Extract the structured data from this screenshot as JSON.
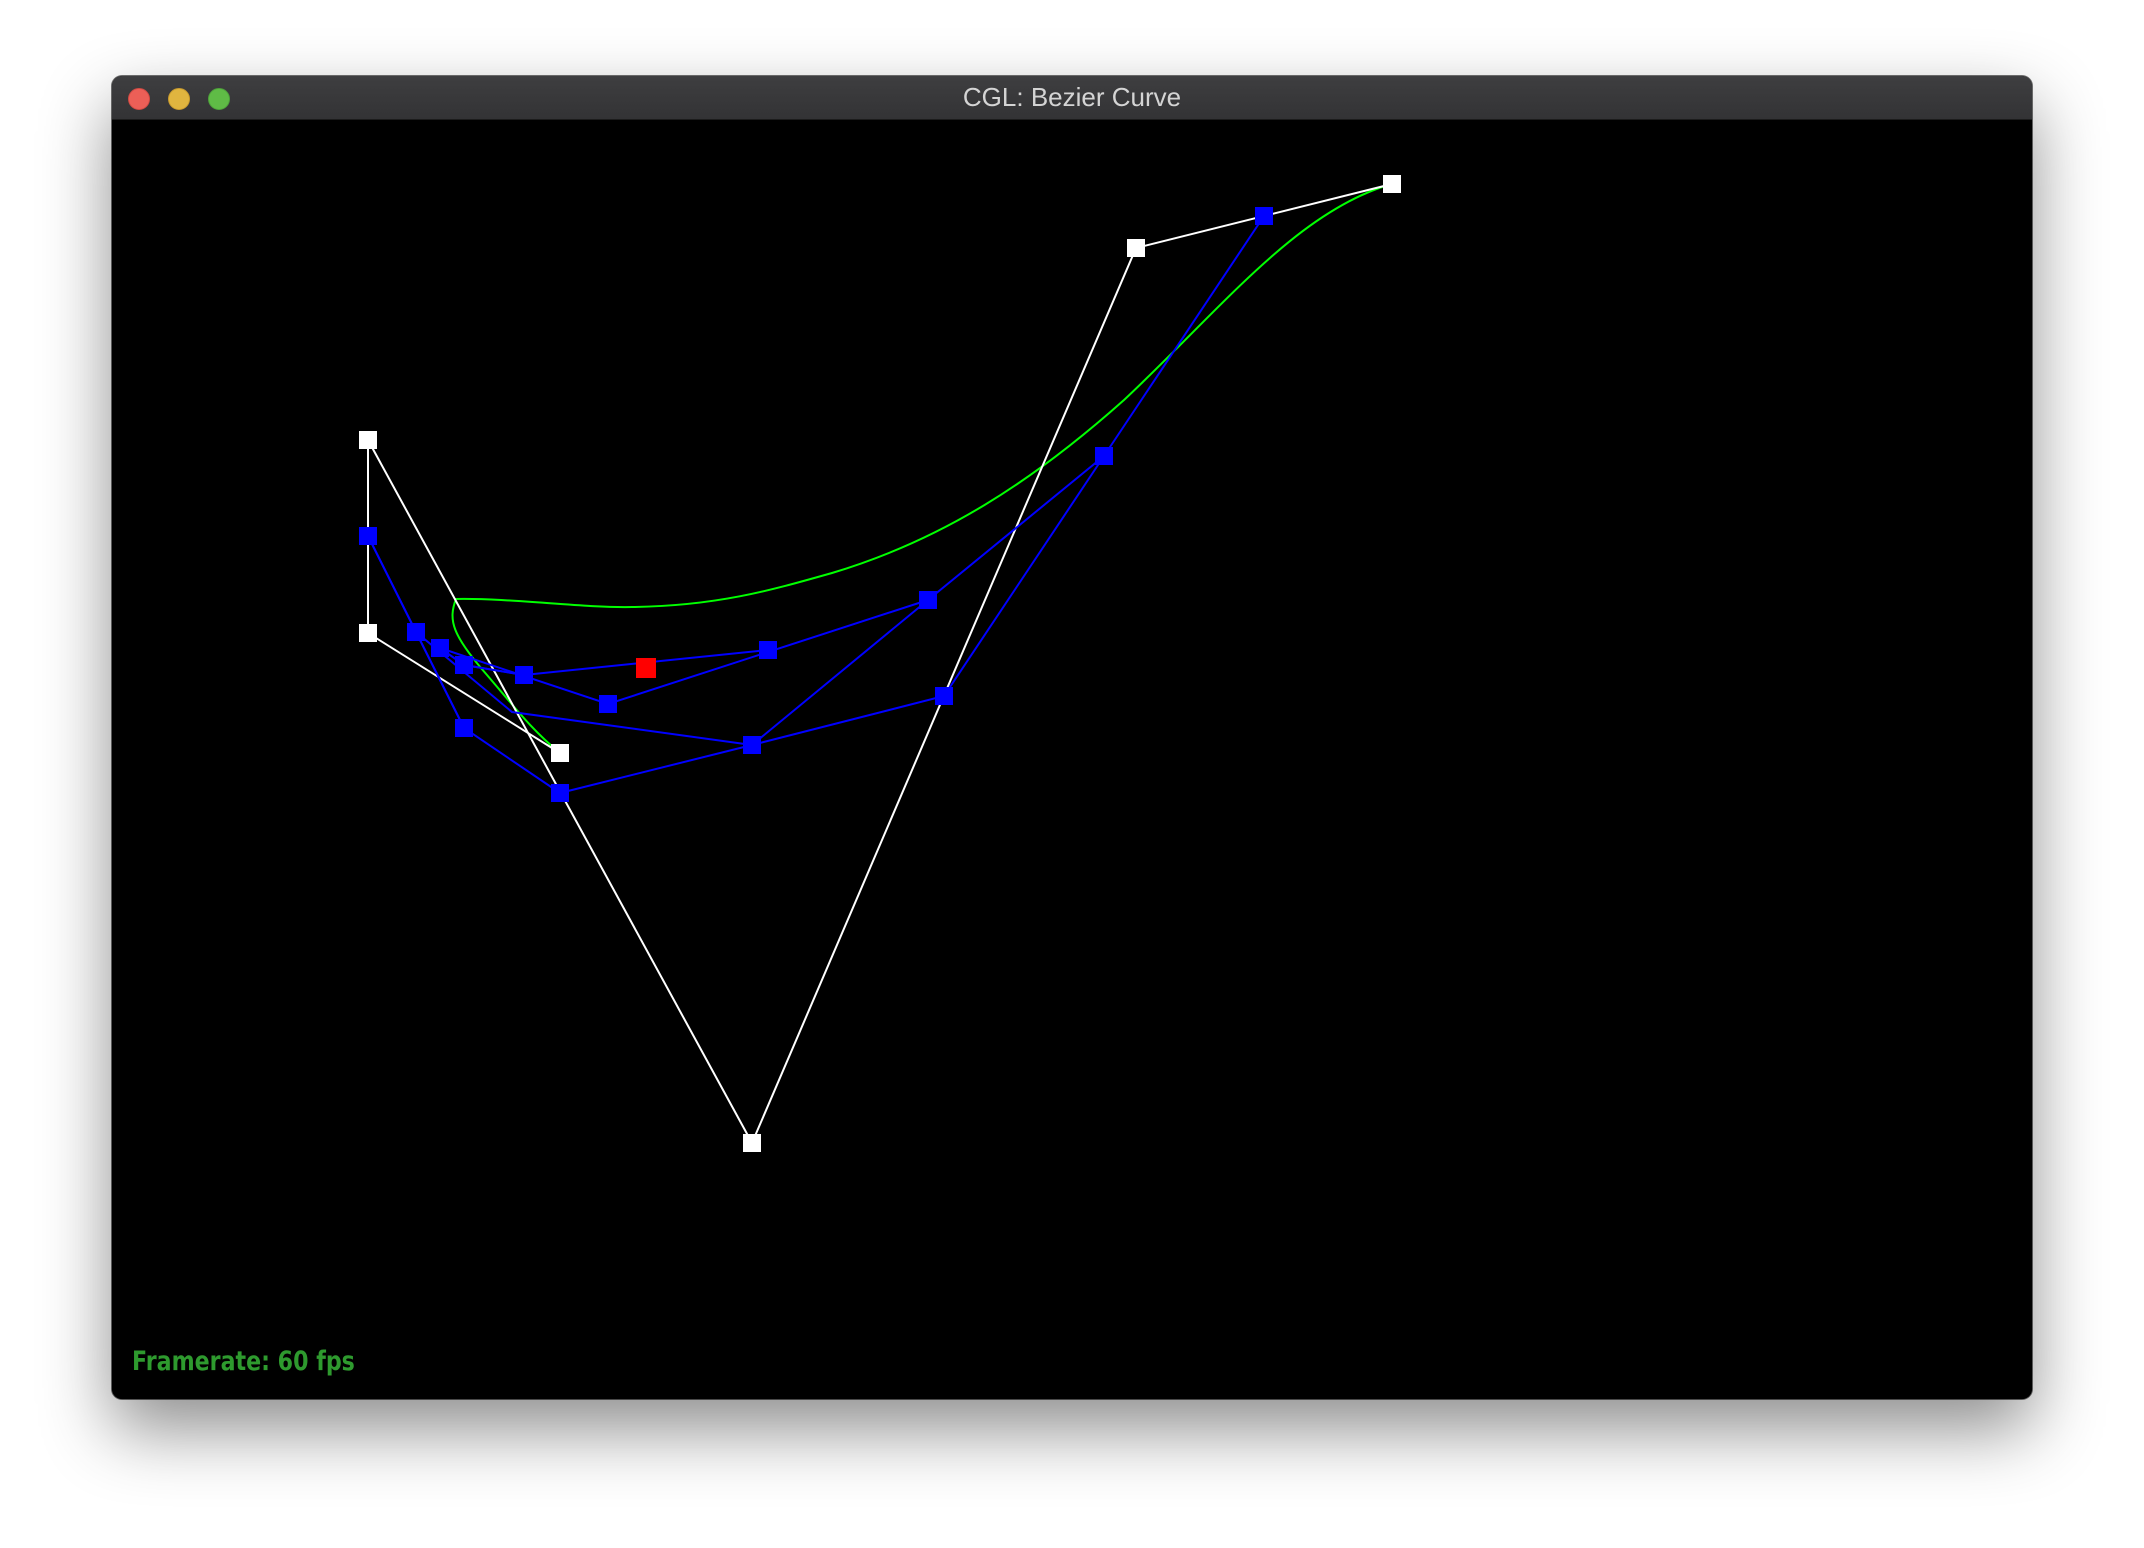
{
  "window": {
    "title": "CGL: Bezier Curve"
  },
  "status": {
    "framerate": "Framerate: 60 fps"
  },
  "colors": {
    "background": "#000000",
    "control_polygon": "#ffffff",
    "intermediate": "#0000ff",
    "curve": "#00ff00",
    "evaluated_point": "#ff0000",
    "framerate_text": "#2e9a2e"
  },
  "icons": [
    "close-button-icon",
    "minimize-button-icon",
    "zoom-button-icon"
  ]
}
